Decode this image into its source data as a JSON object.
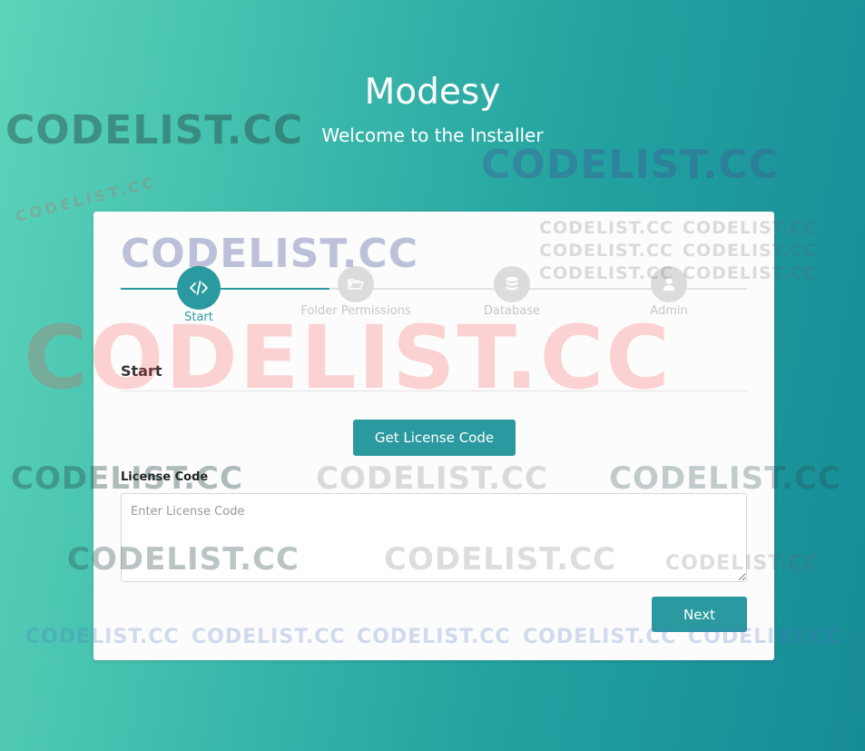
{
  "header": {
    "title": "Modesy",
    "subtitle": "Welcome to the Installer"
  },
  "stepper": {
    "steps": [
      {
        "label": "Start",
        "icon": "code-icon",
        "active": true
      },
      {
        "label": "Folder Permissions",
        "icon": "folder-open-icon",
        "active": false
      },
      {
        "label": "Database",
        "icon": "database-icon",
        "active": false
      },
      {
        "label": "Admin",
        "icon": "user-icon",
        "active": false
      }
    ]
  },
  "section": {
    "title": "Start"
  },
  "license": {
    "get_button": "Get License Code",
    "label": "License Code",
    "placeholder": "Enter License Code",
    "value": ""
  },
  "actions": {
    "next": "Next"
  },
  "watermark": {
    "text": "CODELIST.CC"
  },
  "colors": {
    "accent": "#2b9aa0",
    "background_start": "#5cd4b9",
    "background_end": "#168b96",
    "inactive_step": "#dcdcdc",
    "card": "#fcfcfc"
  }
}
